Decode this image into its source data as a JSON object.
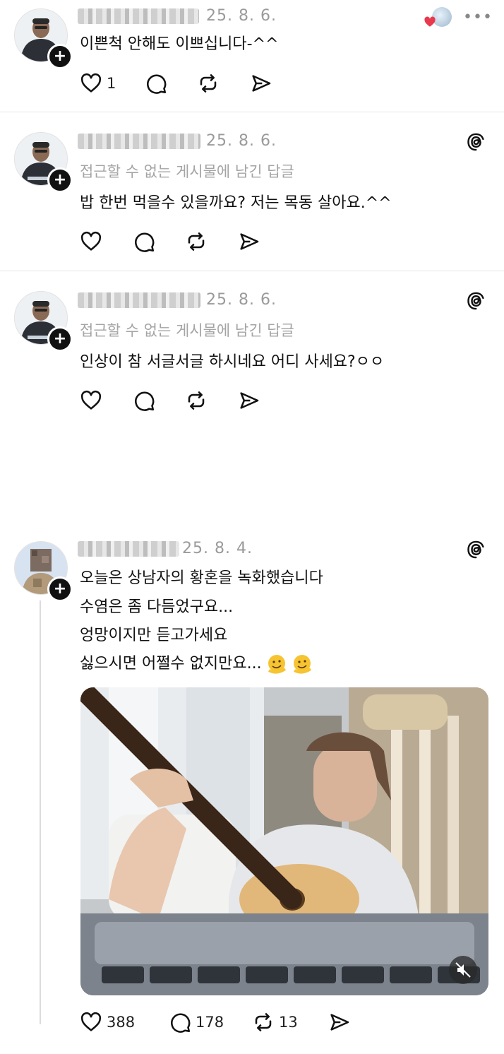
{
  "posts": [
    {
      "date": "25. 8. 6.",
      "subtitle": "",
      "text": "이쁜척 안해도 이쁘십니다-^^",
      "like_count": "1",
      "reply_count": "",
      "repost_count": ""
    },
    {
      "date": "25. 8. 6.",
      "subtitle": "접근할 수 없는 게시물에 남긴 답글",
      "text": "밥 한번 먹을수 있을까요? 저는 목동 살아요.^^"
    },
    {
      "date": "25. 8. 6.",
      "subtitle": "접근할 수 없는 게시물에 남긴 답글",
      "text": "인상이 참 서글서글 하시네요 어디 사세요?ㅇㅇ"
    },
    {
      "date": "25. 8. 4.",
      "lines": [
        "오늘은 상남자의 황혼을 녹화했습니다",
        "수염은 좀 다듬었구요...",
        "엉망이지만 듣고가세요",
        "싫으시면 어쩔수 없지만요..."
      ],
      "like_count": "388",
      "reply_count": "178",
      "repost_count": "13"
    }
  ],
  "icons": {
    "like": "heart-icon",
    "reply": "speech-bubble-icon",
    "repost": "repost-icon",
    "share": "send-icon",
    "more": "more-dots-icon",
    "threads": "threads-logo-icon",
    "follow": "plus-icon",
    "mute": "muted-speaker-icon"
  },
  "colors": {
    "heart_reaction": "#e8394d",
    "text": "#111111",
    "muted_text": "#9a9a9a"
  }
}
